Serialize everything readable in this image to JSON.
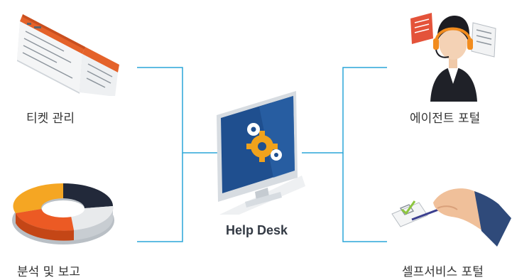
{
  "center": {
    "label": "Help Desk"
  },
  "nodes": {
    "ticket": {
      "label": "티켓 관리"
    },
    "report": {
      "label": "분석 및 보고"
    },
    "agent": {
      "label": "에이전트 포털"
    },
    "self_service": {
      "label": "셀프서비스 포털"
    }
  },
  "colors": {
    "connector": "#2aa6d8",
    "monitor_screen": "#1f4f8f",
    "gear_orange": "#f0a21c",
    "ticket_orange": "#e4622a",
    "headset_orange": "#f28c1e"
  },
  "icons": [
    "ticket-icon",
    "donut-chart-icon",
    "monitor-gears-icon",
    "agent-headset-icon",
    "checklist-hand-icon"
  ]
}
